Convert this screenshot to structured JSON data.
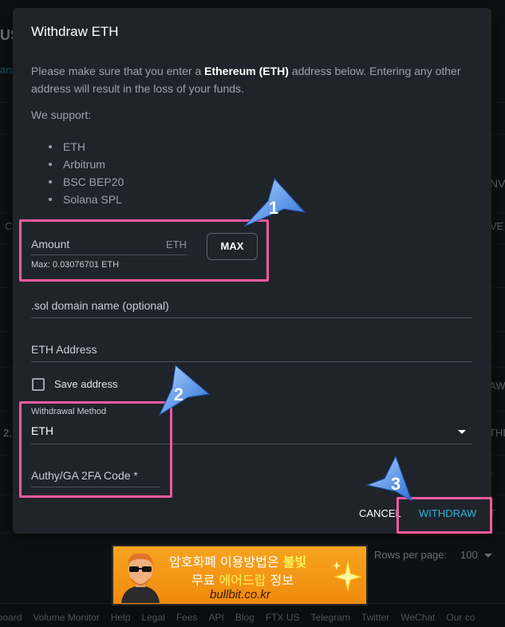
{
  "modal": {
    "title": "Withdraw ETH",
    "notice_before": "Please make sure that you enter a ",
    "notice_bold": "Ethereum (ETH)",
    "notice_after": " address below. Entering any other address will result in the loss of your funds.",
    "support_label": "We support:",
    "supported_networks": [
      "ETH",
      "Arbitrum",
      "BSC BEP20",
      "Solana SPL"
    ],
    "amount": {
      "label": "Amount",
      "unit": "ETH",
      "max_note": "Max: 0.03076701 ETH",
      "max_button": "MAX"
    },
    "sol_domain": {
      "label": ".sol domain name (optional)"
    },
    "eth_address": {
      "label": "ETH Address"
    },
    "save_address": {
      "label": "Save address",
      "checked": false
    },
    "withdrawal_method": {
      "label": "Withdrawal Method",
      "value": "ETH"
    },
    "two_fa": {
      "label": "Authy/GA 2FA Code *"
    },
    "cancel_button": "CANCEL",
    "withdraw_button": "WITHDRAW"
  },
  "annotations": {
    "steps": [
      "1",
      "2",
      "3"
    ],
    "highlight_color": "#f45ba0",
    "arrow_color": "#3d7fe0"
  },
  "background": {
    "left_fragments": [
      "US",
      "ana",
      "C",
      "2,"
    ],
    "right_fragments": [
      "NV",
      "VE",
      "/",
      "AW",
      "THD",
      "/",
      "T"
    ],
    "rows_per_page_label": "Rows per page:",
    "rows_per_page_value": "100",
    "footer_links": [
      "erboard",
      "Volume Monitor",
      "Help",
      "Legal",
      "Fees",
      "API",
      "Blog",
      "FTX US",
      "Telegram",
      "Twitter",
      "WeChat",
      "Our co"
    ]
  },
  "ad_banner": {
    "line1_prefix": "암호화폐 이용방법은",
    "line1_highlight": "불빛",
    "line2_prefix": "무료",
    "line2_highlight": "에어드랍",
    "line2_suffix": "정보",
    "url": "bullbit.co.kr"
  },
  "colors": {
    "modal_bg": "#1f242a",
    "accent": "#2bb3d6",
    "page_bg": "#1b1f24"
  }
}
